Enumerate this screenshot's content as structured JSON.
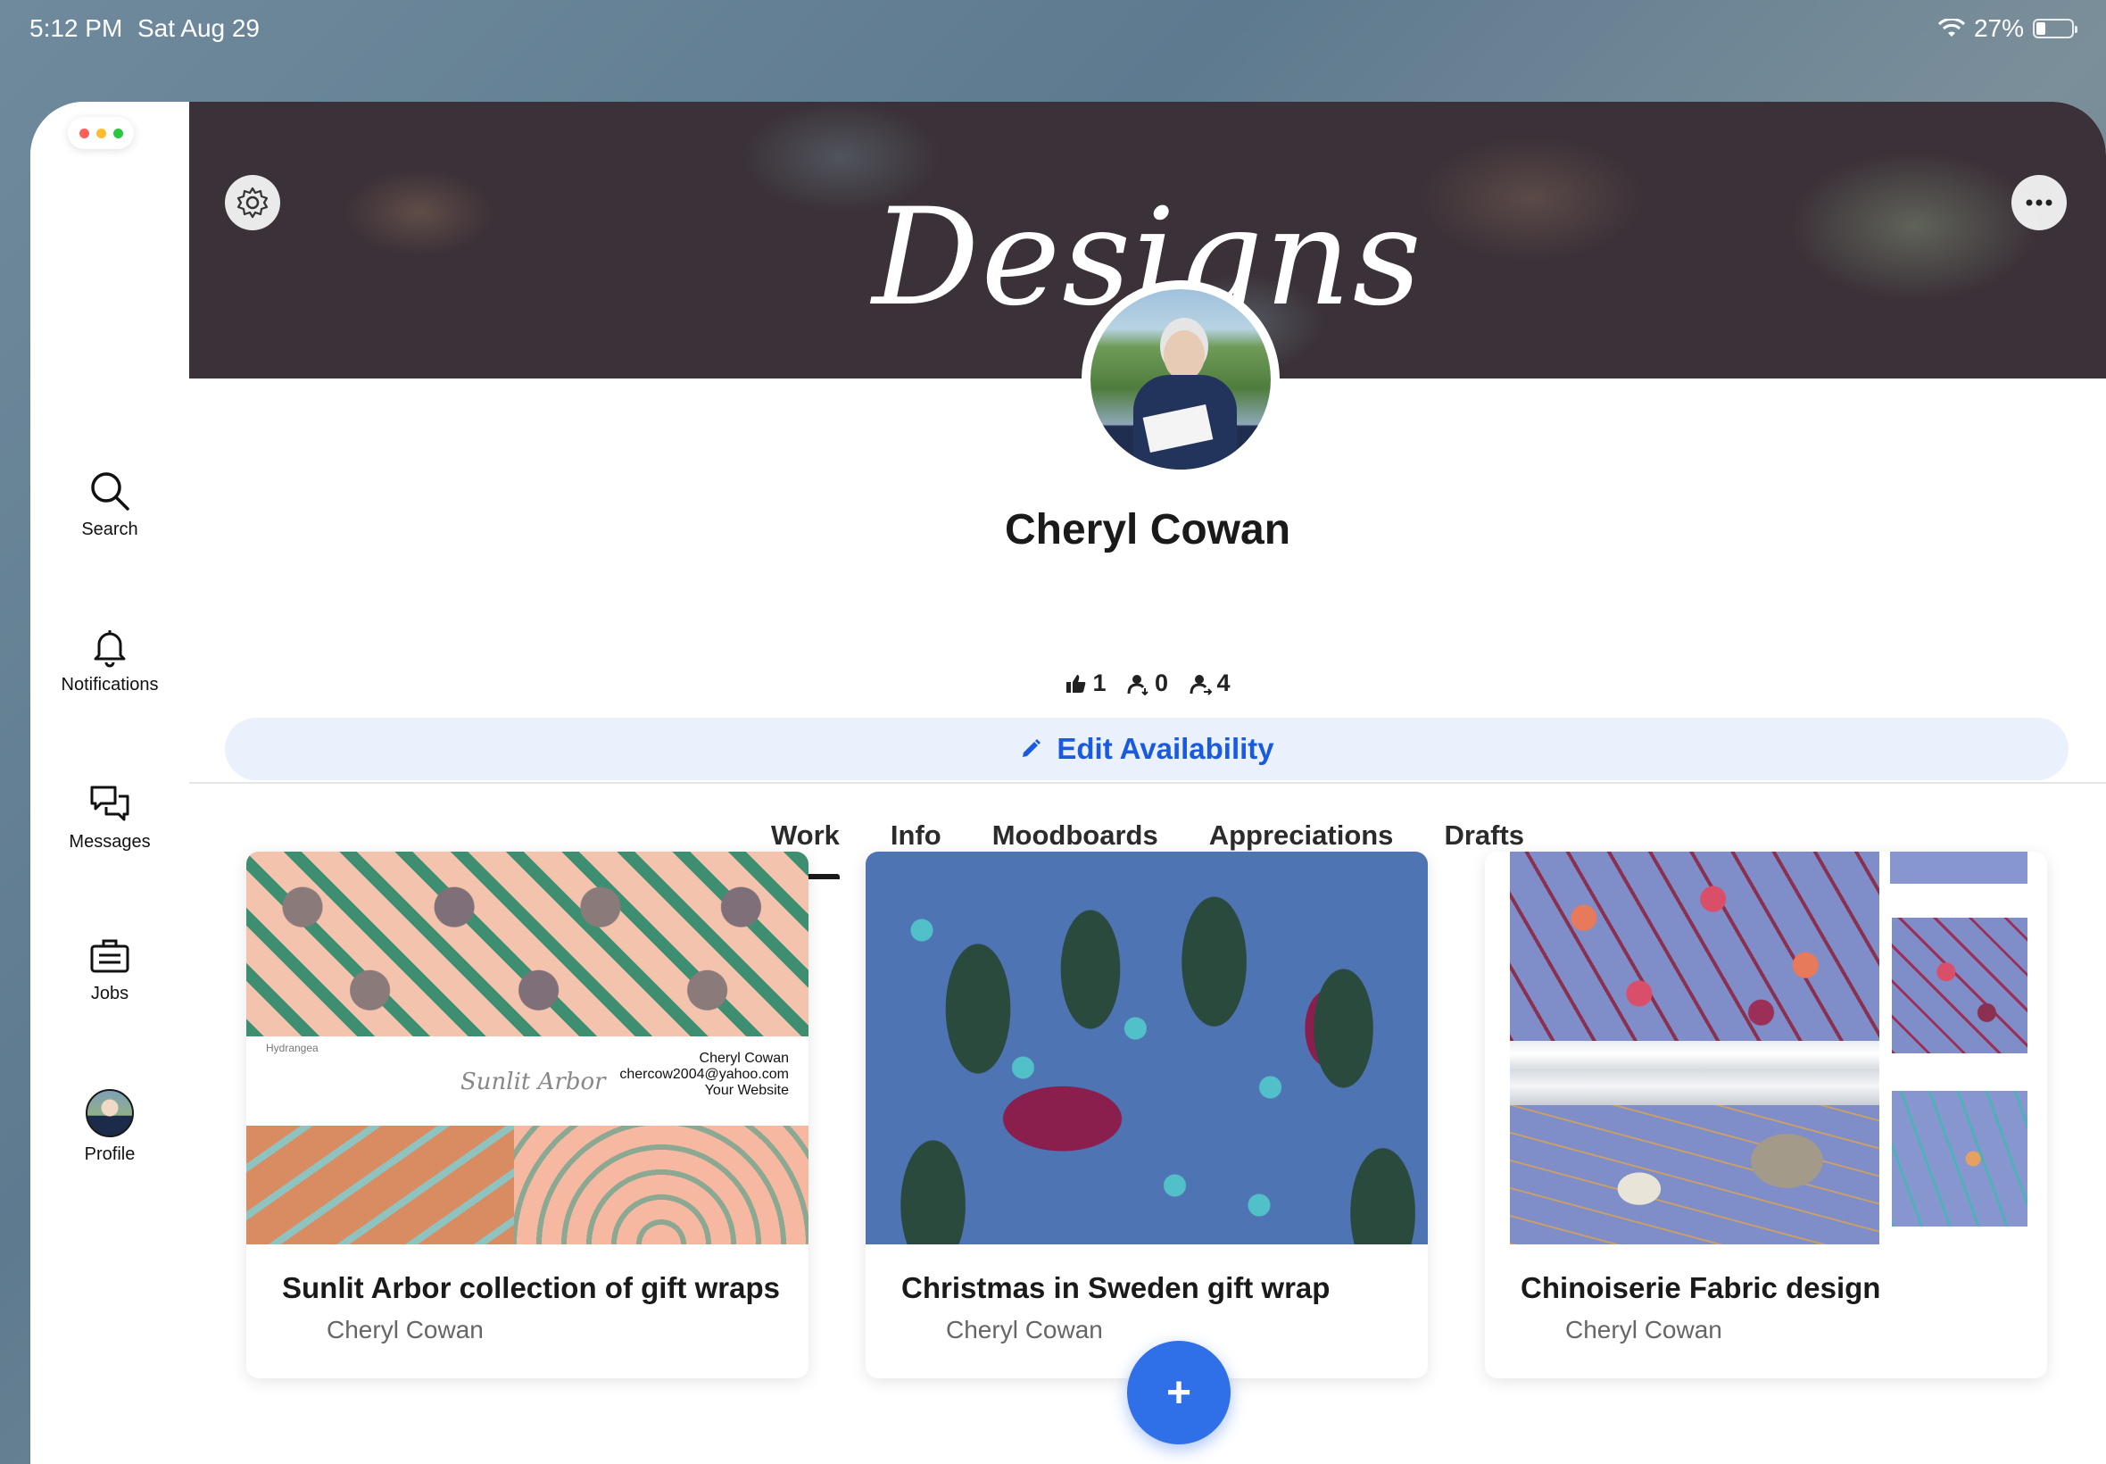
{
  "status_bar": {
    "time": "5:12 PM",
    "date": "Sat Aug 29",
    "battery": "27%",
    "battery_level": 0.27,
    "icons": [
      "wifi-icon",
      "battery-icon"
    ]
  },
  "window_controls": {
    "colors": [
      "#ff5f57",
      "#febc2e",
      "#28c840"
    ]
  },
  "sidebar": {
    "items": [
      {
        "label": "Search",
        "icon": "search-icon"
      },
      {
        "label": "Notifications",
        "icon": "bell-icon"
      },
      {
        "label": "Messages",
        "icon": "chat-bubbles-icon"
      },
      {
        "label": "Jobs",
        "icon": "briefcase-icon"
      },
      {
        "label": "Profile",
        "icon": "avatar"
      }
    ]
  },
  "banner": {
    "title": "Designs",
    "settings_icon": "gear-icon",
    "more_icon": "ellipsis-icon"
  },
  "profile": {
    "name": "Cheryl Cowan",
    "stats": {
      "appreciations": "1",
      "followers": "0",
      "following": "4"
    }
  },
  "availability_button": {
    "label": "Edit Availability",
    "icon": "pencil-icon"
  },
  "tabs": [
    {
      "label": "Work",
      "active": true
    },
    {
      "label": "Info",
      "active": false
    },
    {
      "label": "Moodboards",
      "active": false
    },
    {
      "label": "Appreciations",
      "active": false
    },
    {
      "label": "Drafts",
      "active": false
    }
  ],
  "projects": [
    {
      "title": "Sunlit Arbor collection of gift wraps",
      "owner": "Cheryl Cowan",
      "image_text": {
        "pattern_name": "Hydrangea",
        "signature": "Sunlit Arbor",
        "contact_name": "Cheryl Cowan",
        "contact_email": "chercow2004@yahoo.com",
        "contact_site": "Your Website"
      }
    },
    {
      "title": "Christmas in Sweden gift wrap",
      "owner": "Cheryl Cowan"
    },
    {
      "title": "Chinoiserie Fabric design",
      "owner": "Cheryl Cowan"
    }
  ],
  "fab": {
    "label": "+"
  },
  "colors": {
    "accent": "#1a5ae0",
    "availability_bg": "#eaf1fc",
    "fab": "#2f6fe8"
  }
}
